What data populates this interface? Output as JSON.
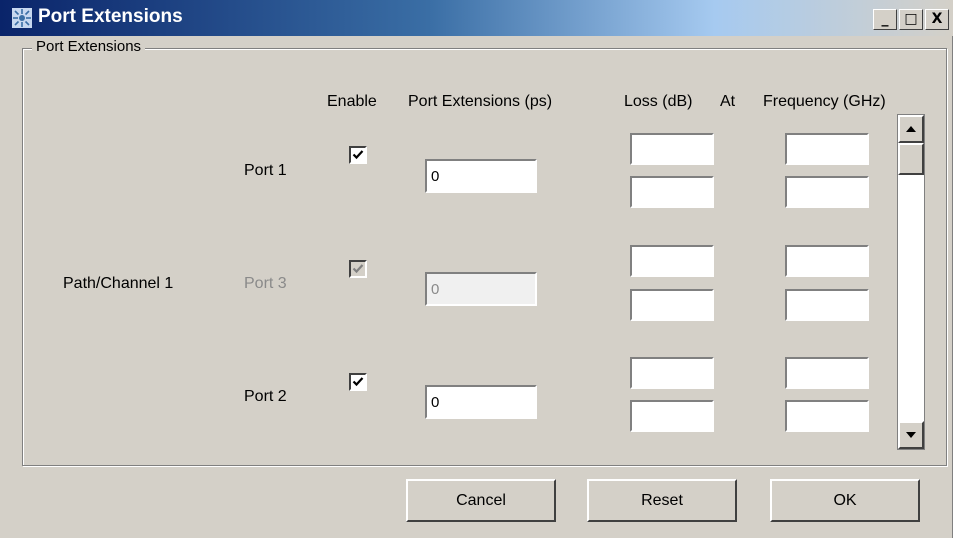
{
  "window": {
    "title": "Port Extensions",
    "controls": {
      "minimize": "_",
      "maximize": "□",
      "close": "X"
    }
  },
  "group": {
    "title": "Port Extensions"
  },
  "headers": {
    "enable": "Enable",
    "port_extensions": "Port Extensions (ps)",
    "loss": "Loss (dB)",
    "at": "At",
    "frequency": "Frequency (GHz)"
  },
  "path_label": "Path/Channel 1",
  "ports": [
    {
      "label": "Port 1",
      "enabled": true,
      "disabled": false,
      "extension": "0"
    },
    {
      "label": "Port 3",
      "enabled": true,
      "disabled": true,
      "extension": "0"
    },
    {
      "label": "Port 2",
      "enabled": true,
      "disabled": false,
      "extension": "0"
    }
  ],
  "buttons": {
    "cancel": "Cancel",
    "reset": "Reset",
    "ok": "OK"
  }
}
